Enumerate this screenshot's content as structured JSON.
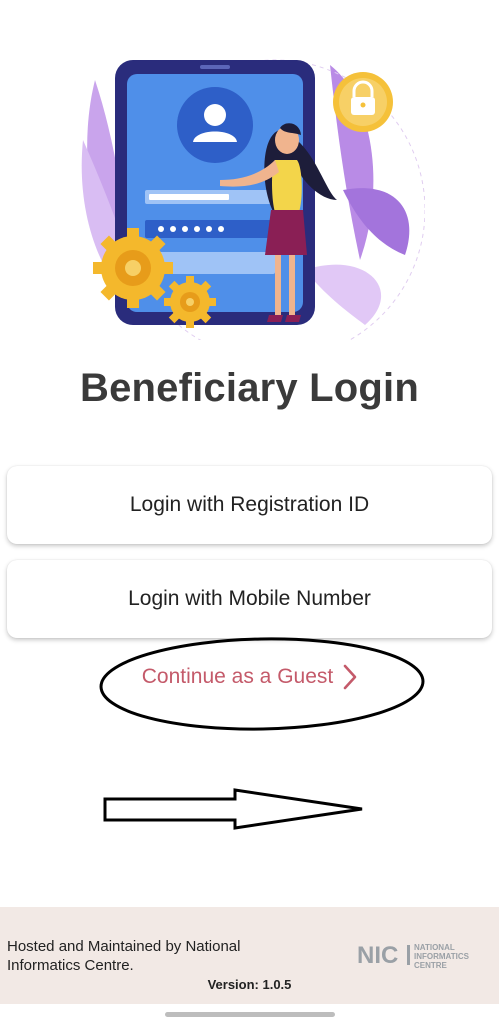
{
  "login": {
    "title": "Beneficiary Login",
    "registration_button": "Login with Registration ID",
    "mobile_button": "Login with Mobile Number",
    "guest_link": "Continue as a Guest"
  },
  "footer": {
    "hosted_text": "Hosted and Maintained by National Informatics Centre.",
    "version": "Version: 1.0.5",
    "logo_mark": "NIC",
    "logo_text": [
      "NATIONAL",
      "INFORMATICS",
      "CENTRE"
    ]
  },
  "colors": {
    "title": "#3a3a3a",
    "guest_link": "#c45a6a",
    "footer_bg": "#f2e9e5",
    "illustration_primary": "#4a8ae8",
    "illustration_accent": "#f5c13a"
  },
  "icons": [
    "user-avatar-icon",
    "padlock-icon",
    "gear-icon",
    "chevron-right-icon",
    "nav-gesture-bar"
  ],
  "annotations": [
    "hand-drawn-ellipse",
    "hand-drawn-arrow"
  ]
}
